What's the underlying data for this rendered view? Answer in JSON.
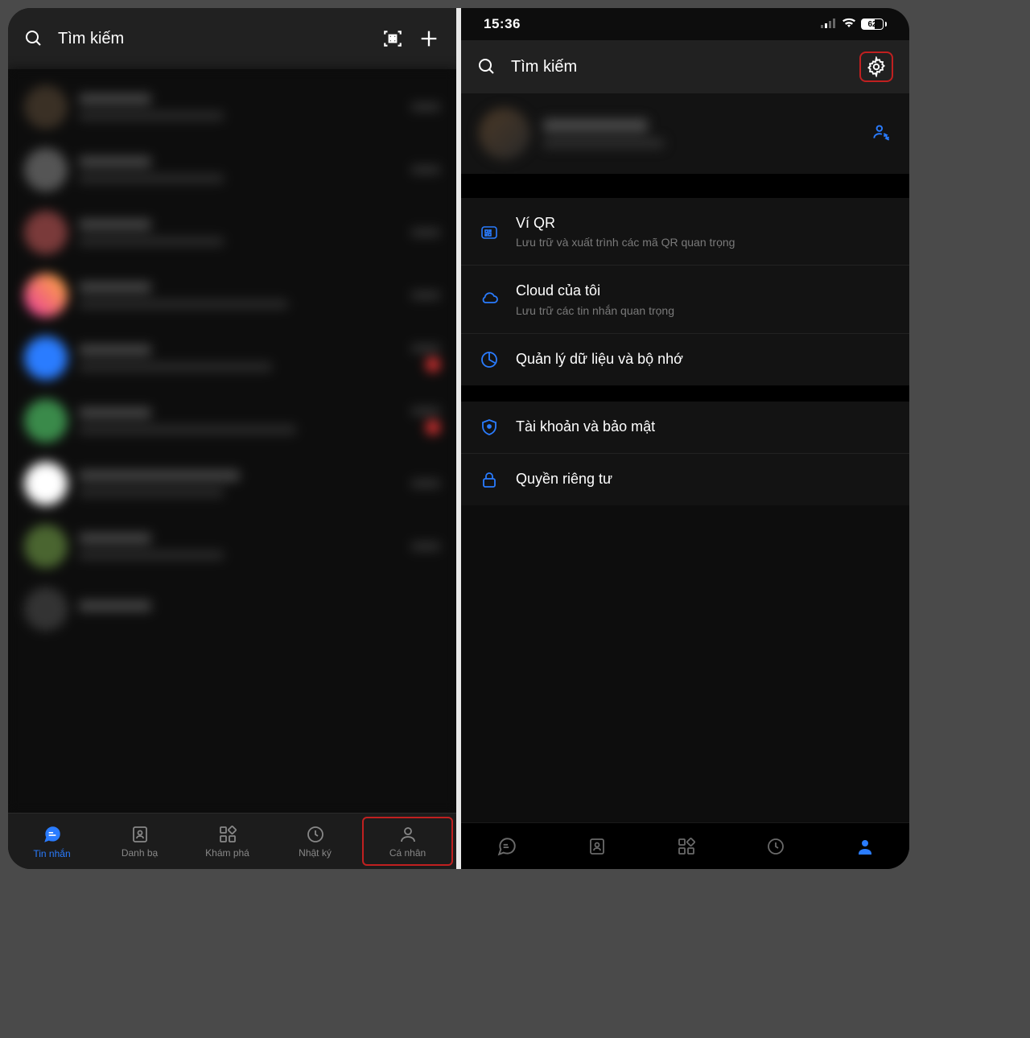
{
  "left": {
    "search_placeholder": "Tìm kiếm",
    "tabs": [
      {
        "label": "Tin nhắn"
      },
      {
        "label": "Danh bạ"
      },
      {
        "label": "Khám phá"
      },
      {
        "label": "Nhật ký"
      },
      {
        "label": "Cá nhân"
      }
    ]
  },
  "right": {
    "status": {
      "time": "15:36",
      "battery": "62"
    },
    "search_placeholder": "Tìm kiếm",
    "menu": [
      {
        "title": "Ví QR",
        "sub": "Lưu trữ và xuất trình các mã QR quan trọng"
      },
      {
        "title": "Cloud của tôi",
        "sub": "Lưu trữ các tin nhắn quan trọng"
      },
      {
        "title": "Quản lý dữ liệu và bộ nhớ",
        "sub": ""
      }
    ],
    "menu2": [
      {
        "title": "Tài khoản và bảo mật",
        "sub": ""
      },
      {
        "title": "Quyền riêng tư",
        "sub": ""
      }
    ]
  }
}
